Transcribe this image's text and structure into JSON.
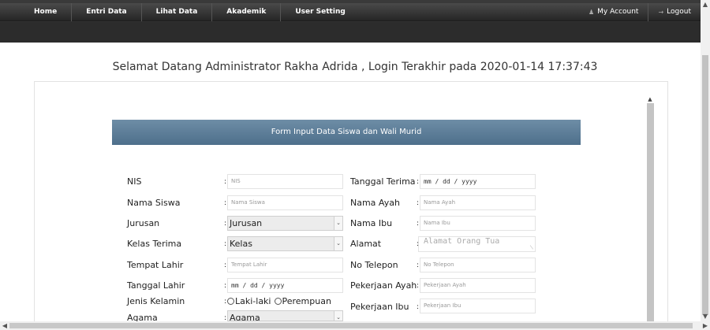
{
  "nav": {
    "items": [
      "Home",
      "Entri Data",
      "Lihat Data",
      "Akademik",
      "User Setting"
    ],
    "my_account": "My Account",
    "logout": "Logout"
  },
  "welcome": "Selamat Datang Administrator Rakha Adrida , Login Terakhir pada 2020-01-14 17:37:43",
  "form": {
    "title": "Form Input Data Siswa dan Wali Murid",
    "colon": ":",
    "left": {
      "nis_label": "NIS",
      "nis_placeholder": "NIS",
      "nama_label": "Nama Siswa",
      "nama_placeholder": "Nama Siswa",
      "jurusan_label": "Jurusan",
      "jurusan_value": "Jurusan",
      "kelas_label": "Kelas Terima",
      "kelas_value": "Kelas",
      "tempat_label": "Tempat Lahir",
      "tempat_placeholder": "Tempat Lahir",
      "tanggal_label": "Tanggal Lahir",
      "tanggal_value": "mm / dd / yyyy",
      "jenis_label": "Jenis Kelamin",
      "jenis_options": [
        "Laki-laki",
        "Perempuan"
      ],
      "agama_label": "Agama",
      "agama_value": "Agama"
    },
    "right": {
      "tgl_terima_label": "Tanggal Terima",
      "tgl_terima_value": "mm / dd / yyyy",
      "ayah_label": "Nama Ayah",
      "ayah_placeholder": "Nama Ayah",
      "ibu_label": "Nama Ibu",
      "ibu_placeholder": "Nama Ibu",
      "alamat_label": "Alamat",
      "alamat_placeholder": "Alamat Orang Tua",
      "telp_label": "No Telepon",
      "telp_placeholder": "No Telepon",
      "pek_ayah_label": "Pekerjaan Ayah",
      "pek_ayah_placeholder": "Pekerjaan Ayah",
      "pek_ibu_label": "Pekerjaan Ibu",
      "pek_ibu_placeholder": "Pekerjaan Ibu"
    }
  }
}
